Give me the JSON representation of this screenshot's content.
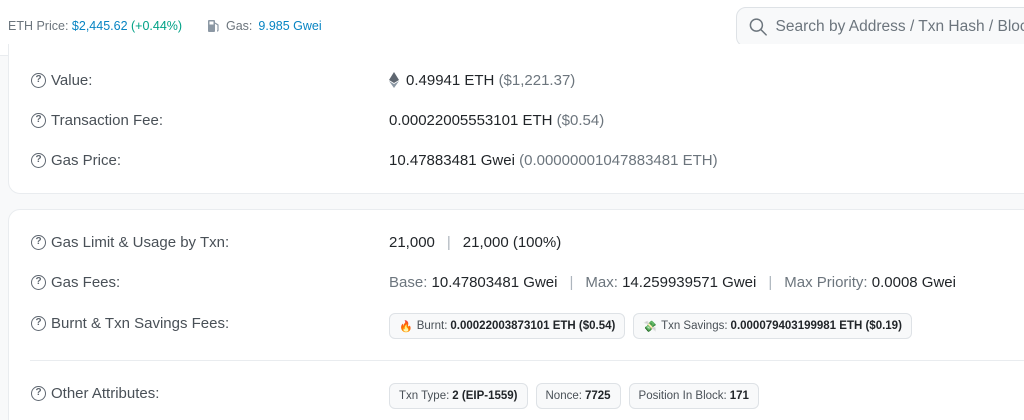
{
  "header": {
    "eth_price_label": "ETH Price:",
    "eth_price_value": "$2,445.62",
    "eth_price_change": "(+0.44%)",
    "gas_label": "Gas:",
    "gas_value": "9.985 Gwei",
    "search_placeholder": "Search by Address / Txn Hash / Block"
  },
  "card1": {
    "value": {
      "label": "Value:",
      "amount": "0.49941 ETH",
      "usd": "($1,221.37)"
    },
    "fee": {
      "label": "Transaction Fee:",
      "amount": "0.00022005553101 ETH",
      "usd": "($0.54)"
    },
    "gas_price": {
      "label": "Gas Price:",
      "amount": "10.47883481 Gwei",
      "eth": "(0.00000001047883481 ETH)"
    }
  },
  "card2": {
    "gas_limit": {
      "label": "Gas Limit & Usage by Txn:",
      "limit": "21,000",
      "sep": "|",
      "usage": "21,000 (100%)"
    },
    "gas_fees": {
      "label": "Gas Fees:",
      "base_label": "Base:",
      "base_value": "10.47803481 Gwei",
      "max_label": "Max:",
      "max_value": "14.259939571 Gwei",
      "priority_label": "Max Priority:",
      "priority_value": "0.0008 Gwei",
      "sep": "|"
    },
    "burnt": {
      "label": "Burnt & Txn Savings Fees:",
      "burnt_label": "Burnt:",
      "burnt_value": "0.00022003873101 ETH ($0.54)",
      "savings_label": "Txn Savings:",
      "savings_value": "0.000079403199981 ETH ($0.19)"
    },
    "other": {
      "label": "Other Attributes:",
      "txn_type_label": "Txn Type:",
      "txn_type_value": "2 (EIP-1559)",
      "nonce_label": "Nonce:",
      "nonce_value": "7725",
      "position_label": "Position In Block:",
      "position_value": "171"
    }
  },
  "colors": {
    "link": "#0784c3",
    "positive": "#00a186",
    "muted": "#6c757d"
  },
  "icons": {
    "question": "question-circle-icon",
    "eth": "ethereum-icon",
    "gas": "gas-pump-icon",
    "search": "search-icon",
    "fire": "fire-icon",
    "savings": "money-icon"
  }
}
